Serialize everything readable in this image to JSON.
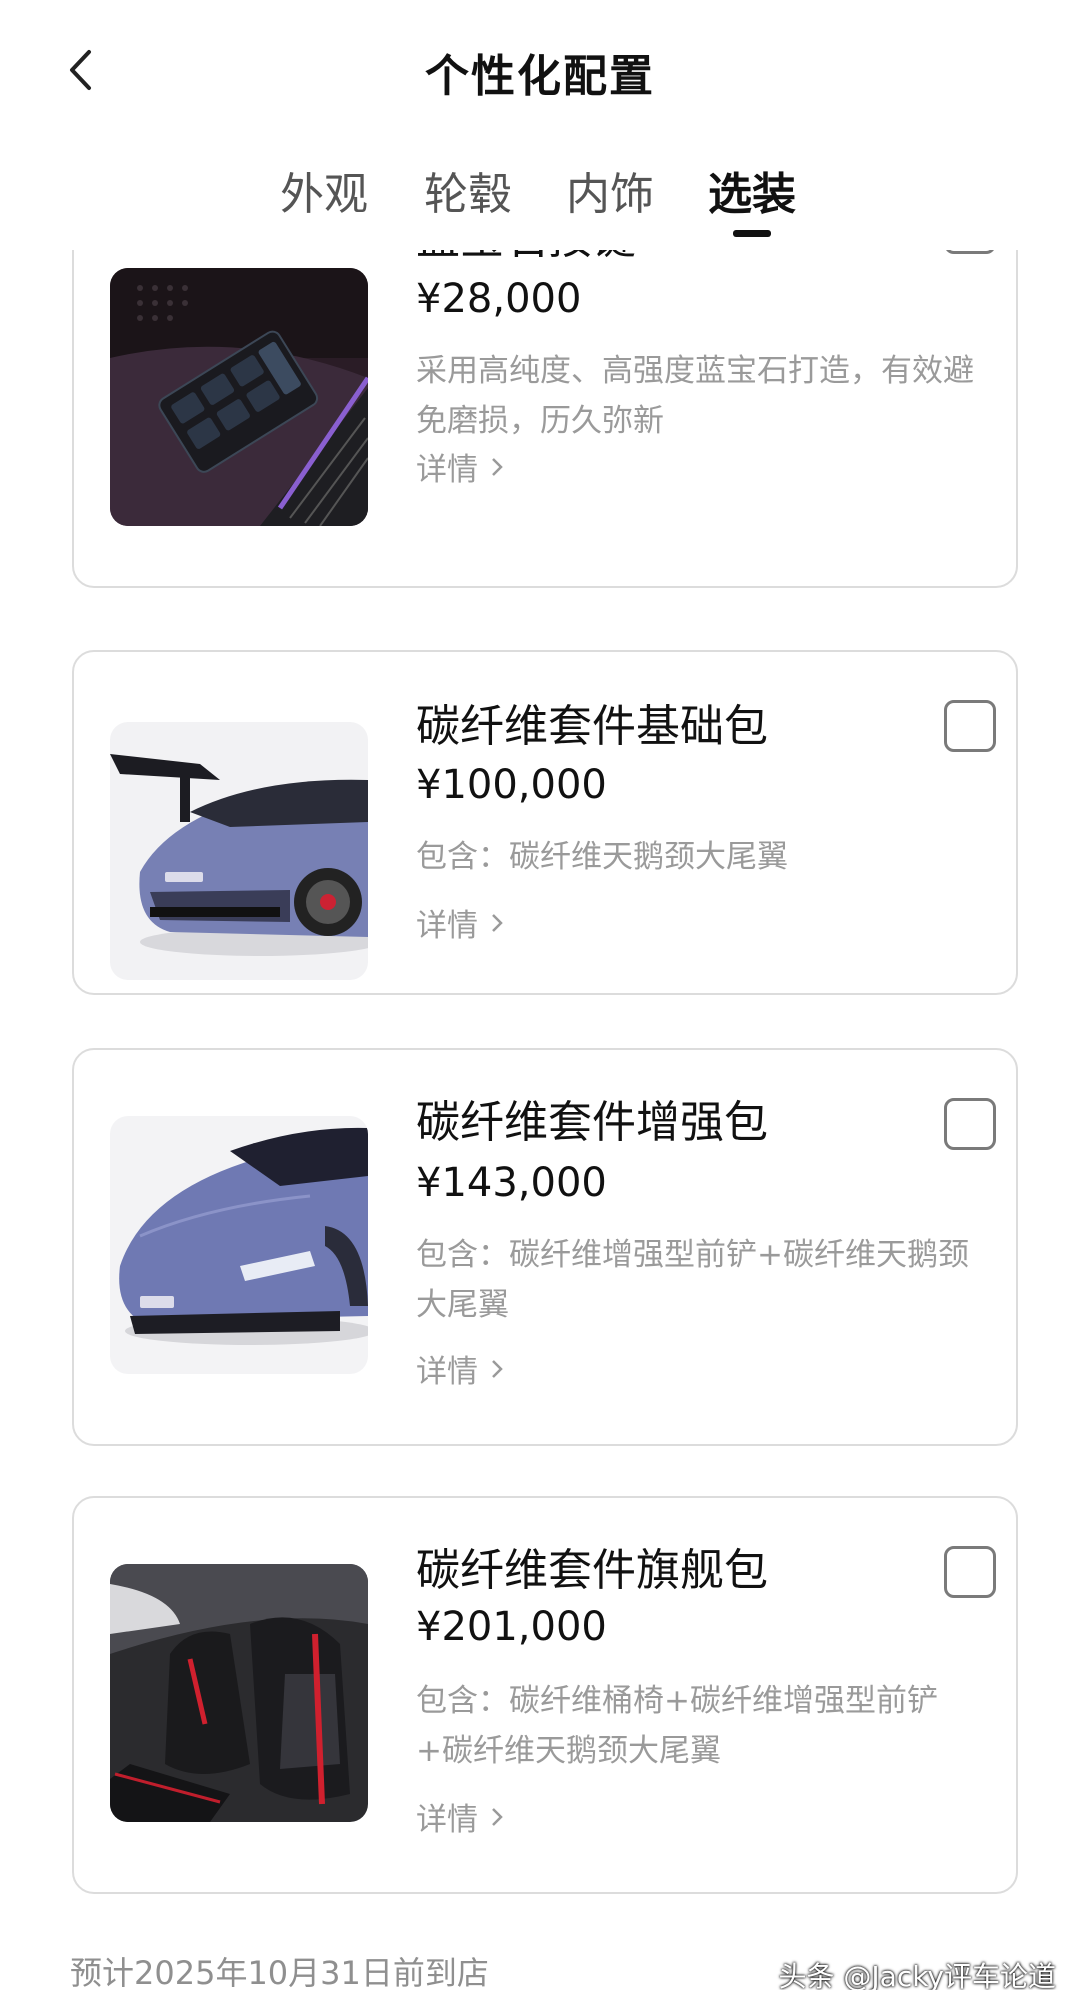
{
  "header": {
    "title": "个性化配置",
    "back_icon": "chevron-left-icon"
  },
  "tabs": [
    {
      "label": "外观",
      "active": false
    },
    {
      "label": "轮毂",
      "active": false
    },
    {
      "label": "内饰",
      "active": false
    },
    {
      "label": "选装",
      "active": true
    }
  ],
  "options": [
    {
      "name": "蓝宝石按键",
      "price": "¥28,000",
      "desc": "采用高纯度、高强度蓝宝石打造，有效避免磨损，历久弥新",
      "detail": "详情",
      "checked": false,
      "image": "sapphire-buttons-image"
    },
    {
      "name": "碳纤维套件基础包",
      "price": "¥100,000",
      "desc": "包含：碳纤维天鹅颈大尾翼",
      "detail": "详情",
      "checked": false,
      "image": "carbon-basic-package-image"
    },
    {
      "name": "碳纤维套件增强包",
      "price": "¥143,000",
      "desc": "包含：碳纤维增强型前铲+碳纤维天鹅颈大尾翼",
      "detail": "详情",
      "checked": false,
      "image": "carbon-enhanced-package-image"
    },
    {
      "name": "碳纤维套件旗舰包",
      "price": "¥201,000",
      "desc": "包含：碳纤维桶椅+碳纤维增强型前铲+碳纤维天鹅颈大尾翼",
      "detail": "详情",
      "checked": false,
      "image": "carbon-flagship-package-image"
    }
  ],
  "footer": {
    "arrival_note": "预计2025年10月31日前到店"
  },
  "watermark": "头条 @Jacky评车论道",
  "colors": {
    "text_primary": "#111111",
    "text_secondary": "#9a9a9a",
    "border": "#dcdcdc",
    "background": "#ffffff"
  }
}
